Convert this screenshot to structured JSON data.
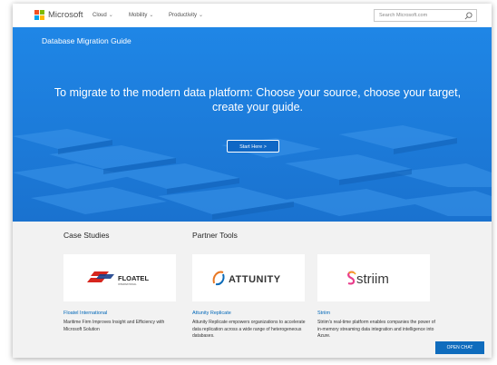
{
  "nav": {
    "brand": "Microsoft",
    "logo_colors": [
      "#f25022",
      "#7fba00",
      "#00a4ef",
      "#ffb900"
    ],
    "items": [
      {
        "label": "Cloud",
        "caret": "⌄"
      },
      {
        "label": "Mobility",
        "caret": "⌄"
      },
      {
        "label": "Productivity",
        "caret": "⌄"
      }
    ],
    "search_placeholder": "Search Microsoft.com",
    "search_icon": "search-icon"
  },
  "hero": {
    "guide_title": "Database Migration Guide",
    "headline": "To migrate to the modern data platform: Choose your source, choose your target, create your guide.",
    "start_label": "Start Here >",
    "accent": "#1e7cd9"
  },
  "sections": {
    "case_studies": "Case Studies",
    "partner_tools": "Partner Tools"
  },
  "cards": [
    {
      "logo_text": "FLOATEL",
      "logo_sub": "INTERNATIONAL",
      "title": "Floatel International",
      "desc": "Maritime Firm Improves Insight and Efficiency with Microsoft Solution"
    },
    {
      "logo_text": "ATTUNITY",
      "title": "Attunity Replicate",
      "desc": "Attunity Replicate empowers organizations to accelerate data replication across a wide range of heterogeneous databases."
    },
    {
      "logo_text": "striim",
      "title": "Striim",
      "desc": "Striim's real-time platform enables companies the power of in-memory streaming data integration and intelligence into Azure."
    }
  ],
  "chat_label": "OPEN CHAT"
}
